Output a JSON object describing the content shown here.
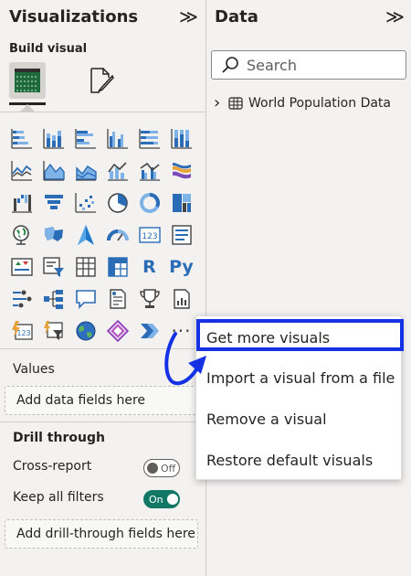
{
  "visualizations_pane": {
    "title": "Visualizations",
    "collapse_glyph": "≫",
    "build_visual_label": "Build visual",
    "build_visual_icon": "table-grid-icon",
    "format_visual_icon": "paintbrush-page-icon",
    "visual_icons": [
      "stacked-bar-chart-icon",
      "stacked-column-chart-icon",
      "clustered-bar-chart-icon",
      "clustered-column-chart-icon",
      "100-percent-stacked-bar-chart-icon",
      "100-percent-stacked-column-chart-icon",
      "line-chart-icon",
      "area-chart-icon",
      "stacked-area-chart-icon",
      "line-and-stacked-column-chart-icon",
      "line-and-clustered-column-chart-icon",
      "ribbon-chart-icon",
      "waterfall-chart-icon",
      "funnel-chart-icon",
      "scatter-chart-icon",
      "pie-chart-icon",
      "donut-chart-icon",
      "treemap-icon",
      "map-icon",
      "filled-map-icon",
      "azure-map-icon",
      "gauge-icon",
      "card-icon",
      "multi-row-card-icon",
      "kpi-icon",
      "slicer-icon",
      "table-icon",
      "matrix-icon",
      "r-script-visual-icon",
      "python-visual-icon",
      "key-influencers-icon",
      "decomposition-tree-icon",
      "qa-icon",
      "smart-narrative-icon",
      "trophy-metrics-icon",
      "paginated-report-icon",
      "power-apps-icon",
      "power-automate-icon",
      "arcgis-map-icon",
      "power-apps-diamond-icon",
      "power-automate-chevron-icon",
      "more-options-icon"
    ],
    "r_glyph": "R",
    "py_glyph": "Py",
    "more_glyph": "···",
    "values_label": "Values",
    "values_well_placeholder": "Add data fields here",
    "drill_through_heading": "Drill through",
    "cross_report_label": "Cross-report",
    "cross_report_toggle": "Off",
    "keep_filters_label": "Keep all filters",
    "keep_filters_toggle": "On",
    "drill_well_placeholder": "Add drill-through fields here"
  },
  "data_pane": {
    "title": "Data",
    "collapse_glyph": "≫",
    "search_placeholder": "Search",
    "tables": [
      {
        "name": "World Population Data",
        "icon": "table-icon",
        "expand_glyph": "›"
      }
    ]
  },
  "context_menu": {
    "items": [
      {
        "label": "Get more visuals",
        "highlighted": true
      },
      {
        "label": "Import a visual from a file"
      },
      {
        "label": "Remove a visual"
      },
      {
        "label": "Restore default visuals"
      }
    ]
  },
  "annotation": {
    "highlight_color": "#1531e6",
    "arrow_color": "#1531e6"
  },
  "colors": {
    "accent_blue": "#2a6cb5",
    "toggle_on": "#117865",
    "pane_bg": "#f3f2f1"
  }
}
